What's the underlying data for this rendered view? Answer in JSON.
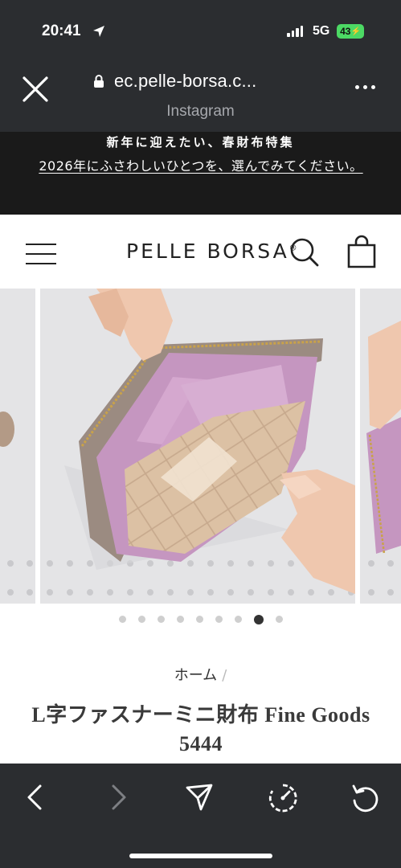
{
  "status_bar": {
    "time": "20:41",
    "network": "5G",
    "battery": "43"
  },
  "browser": {
    "url": "ec.pelle-borsa.c...",
    "subtitle": "Instagram"
  },
  "announcement": {
    "headline": "新年に迎えたい、春財布特集",
    "link_text": "2026年にふさわしいひとつを、選んでみてください。"
  },
  "site": {
    "logo": "PELLE BORSA",
    "logo_mark": "®"
  },
  "carousel": {
    "slide_count": 9,
    "active_index": 7
  },
  "breadcrumb": {
    "home": "ホーム",
    "separator": "/"
  },
  "product": {
    "title": "L字ファスナーミニ財布 Fine Goods 5444"
  },
  "colors": {
    "chrome": "#2b2d30",
    "announcement_bg": "#1a1a1a",
    "battery": "#4cd964",
    "wallet_pink": "#c596c0",
    "lining": "#dcc1a4"
  }
}
